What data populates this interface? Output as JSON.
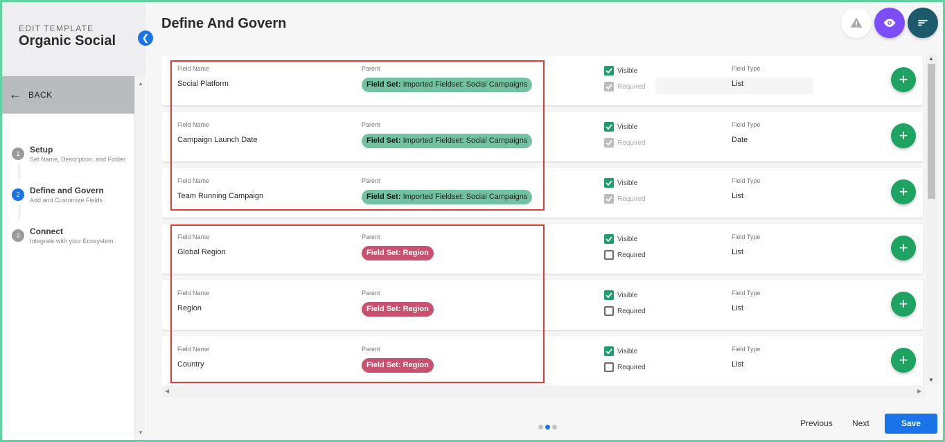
{
  "sidebar": {
    "eyebrow": "EDIT TEMPLATE",
    "title": "Organic Social",
    "back_label": "BACK",
    "steps": [
      {
        "num": "1",
        "title": "Setup",
        "sub": "Set Name, Description, and Folder"
      },
      {
        "num": "2",
        "title": "Define and Govern",
        "sub": "Add and Customize Fields"
      },
      {
        "num": "3",
        "title": "Connect",
        "sub": "Integrate with your Ecosystem"
      }
    ]
  },
  "main": {
    "title": "Define And Govern",
    "labels": {
      "field_name": "Field Name",
      "parent": "Parent",
      "visible": "Visible",
      "required": "Required",
      "field_type": "Field Type"
    },
    "rows": [
      {
        "name": "Social Platform",
        "parent_prefix": "Field Set:",
        "parent_name": "Imported Fieldset: Social Campaigns",
        "type": "List",
        "visible": true,
        "required": "disabled"
      },
      {
        "name": "Campaign Launch Date",
        "parent_prefix": "Field Set:",
        "parent_name": "Imported Fieldset: Social Campaigns",
        "type": "Date",
        "visible": true,
        "required": "disabled"
      },
      {
        "name": "Team Running Campaign",
        "parent_prefix": "Field Set:",
        "parent_name": "Imported Fieldset: Social Campaigns",
        "type": "List",
        "visible": true,
        "required": "disabled"
      },
      {
        "name": "Global Region",
        "parent_prefix": "Field Set:",
        "parent_name": "Region",
        "type": "List",
        "visible": true,
        "required": "unchecked"
      },
      {
        "name": "Region",
        "parent_prefix": "Field Set:",
        "parent_name": "Region",
        "type": "List",
        "visible": true,
        "required": "unchecked"
      },
      {
        "name": "Country",
        "parent_prefix": "Field Set:",
        "parent_name": "Region",
        "type": "List",
        "visible": true,
        "required": "unchecked"
      }
    ]
  },
  "footer": {
    "pagination_count": 3,
    "pagination_active": 2,
    "previous_label": "Previous",
    "next_label": "Next",
    "save_label": "Save"
  },
  "colors": {
    "accent": "#1a73e8",
    "chip_social": "#73c3a2",
    "chip_region": "#c9506f",
    "add_button": "#1ea362",
    "eye_button": "#7c4dff",
    "sort_button": "#1c5a6b",
    "highlight": "#e53935"
  }
}
